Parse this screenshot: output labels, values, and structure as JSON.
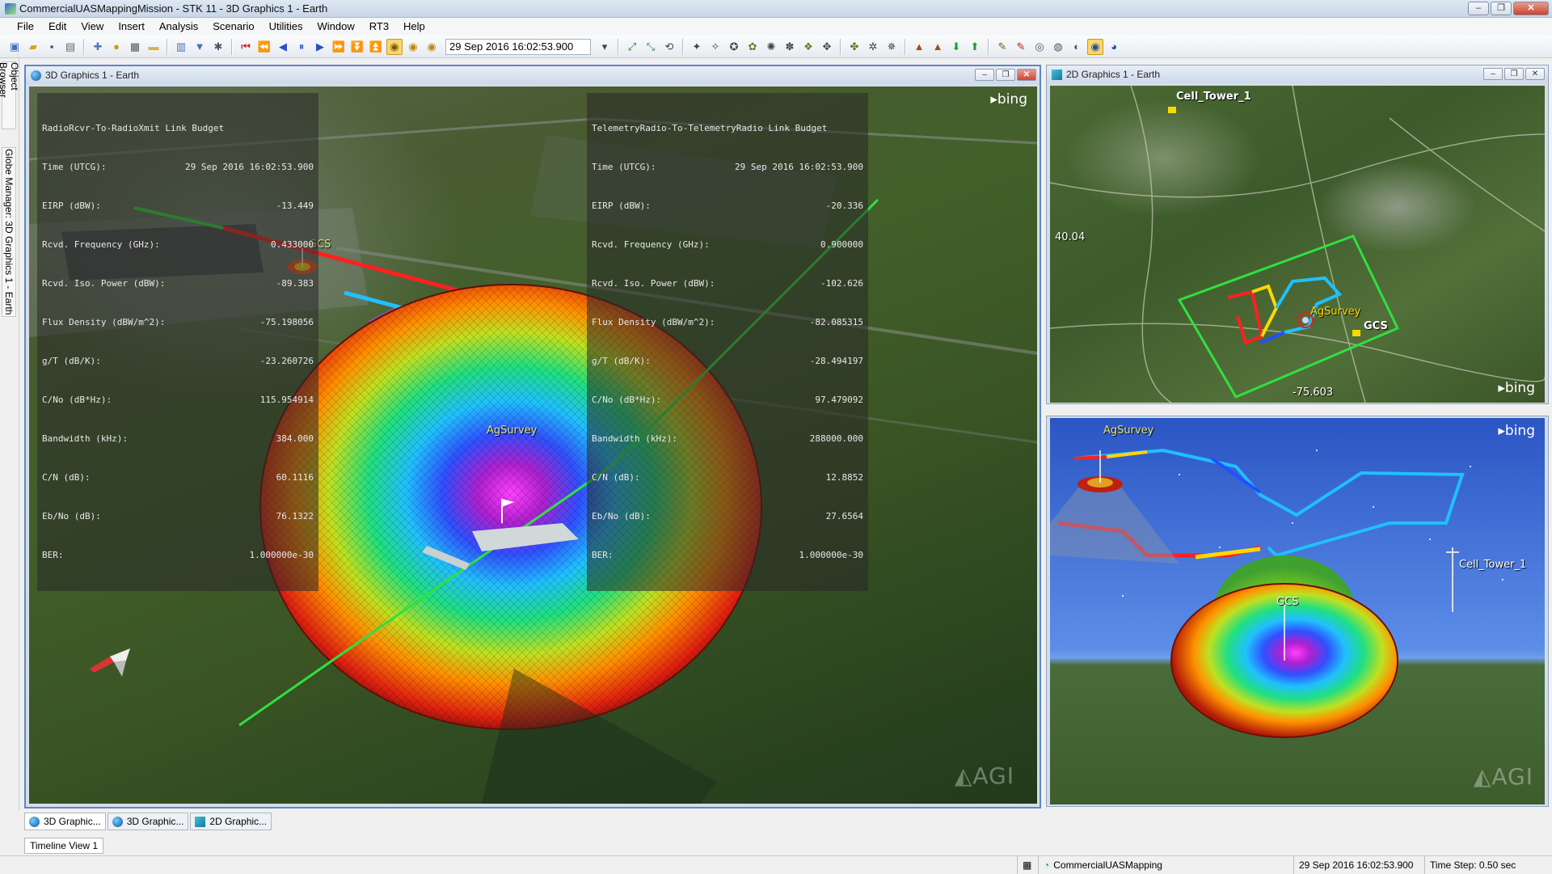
{
  "window": {
    "title": "CommercialUASMappingMission - STK 11 - 3D Graphics 1 - Earth"
  },
  "menu": [
    "File",
    "Edit",
    "View",
    "Insert",
    "Analysis",
    "Scenario",
    "Utilities",
    "Window",
    "RT3",
    "Help"
  ],
  "toolbar": {
    "time": "29 Sep 2016 16:02:53.900",
    "icons": [
      "new-scenario-icon",
      "open-icon",
      "save-icon",
      "print-icon",
      "insert-object-icon",
      "properties-icon",
      "report-icon",
      "reset-icon",
      "step-back-icon",
      "play-back-icon",
      "pause-icon",
      "play-icon",
      "step-forward-icon",
      "decrease-step-icon",
      "increase-step-icon",
      "realtime-icon",
      "clock-icon",
      "zoom-to-icon",
      "measure-icon",
      "view-from-icon",
      "globe-tools-icon",
      "access-icon",
      "coverage-icon",
      "chains-icon",
      "volumetric-icon",
      "move-down-icon",
      "move-up-icon",
      "pencil-icon",
      "target-icon",
      "globe-icon"
    ]
  },
  "sidebar": {
    "object_browser": "Object Browser",
    "globe_manager": "Globe Manager: 3D Graphics 1 - Earth"
  },
  "win_3d_main": {
    "title": "3D Graphics 1 - Earth"
  },
  "win_2d": {
    "title": "2D Graphics 1 - Earth",
    "lat_label": "40.04",
    "lon_label": "-75.603"
  },
  "link_budget_left": {
    "title": "RadioRcvr-To-RadioXmit Link Budget",
    "rows": [
      {
        "label": "Time (UTCG):",
        "value": "29 Sep 2016 16:02:53.900"
      },
      {
        "label": "EIRP (dBW):",
        "value": "-13.449"
      },
      {
        "label": "Rcvd. Frequency (GHz):",
        "value": "0.433000"
      },
      {
        "label": "Rcvd. Iso. Power (dBW):",
        "value": "-89.383"
      },
      {
        "label": "Flux Density (dBW/m^2):",
        "value": "-75.198056"
      },
      {
        "label": "g/T (dB/K):",
        "value": "-23.260726"
      },
      {
        "label": "C/No (dB*Hz):",
        "value": "115.954914"
      },
      {
        "label": "Bandwidth (kHz):",
        "value": "384.000"
      },
      {
        "label": "C/N (dB):",
        "value": "60.1116"
      },
      {
        "label": "Eb/No (dB):",
        "value": "76.1322"
      },
      {
        "label": "BER:",
        "value": "1.000000e-30"
      }
    ]
  },
  "link_budget_right": {
    "title": "TelemetryRadio-To-TelemetryRadio Link Budget",
    "rows": [
      {
        "label": "Time (UTCG):",
        "value": "29 Sep 2016 16:02:53.900"
      },
      {
        "label": "EIRP (dBW):",
        "value": "-20.336"
      },
      {
        "label": "Rcvd. Frequency (GHz):",
        "value": "0.900000"
      },
      {
        "label": "Rcvd. Iso. Power (dBW):",
        "value": "-102.626"
      },
      {
        "label": "Flux Density (dBW/m^2):",
        "value": "-82.085315"
      },
      {
        "label": "g/T (dB/K):",
        "value": "-28.494197"
      },
      {
        "label": "C/No (dB*Hz):",
        "value": "97.479092"
      },
      {
        "label": "Bandwidth (kHz):",
        "value": "288000.000"
      },
      {
        "label": "C/N (dB):",
        "value": "12.8852"
      },
      {
        "label": "Eb/No (dB):",
        "value": "27.6564"
      },
      {
        "label": "BER:",
        "value": "1.000000e-30"
      }
    ]
  },
  "labels": {
    "gcs": "GCS",
    "agsurvey": "AgSurvey",
    "cell_tower": "Cell_Tower_1",
    "bing": "bing",
    "agi": "AGI"
  },
  "doc_tabs": [
    "3D Graphic...",
    "3D Graphic...",
    "2D Graphic..."
  ],
  "timeline": {
    "tab": "Timeline View 1"
  },
  "status": {
    "scenario": "CommercialUASMapping",
    "time": "29 Sep 2016 16:02:53.900",
    "step": "Time Step: 0.50 sec"
  },
  "colors": {
    "ground_station_label": "#e5e57a",
    "path_red": "#ff2020",
    "path_yellow": "#ffd800",
    "path_cyan": "#20c0ff",
    "path_green": "#30e040",
    "bounding_box": "#30e040"
  }
}
